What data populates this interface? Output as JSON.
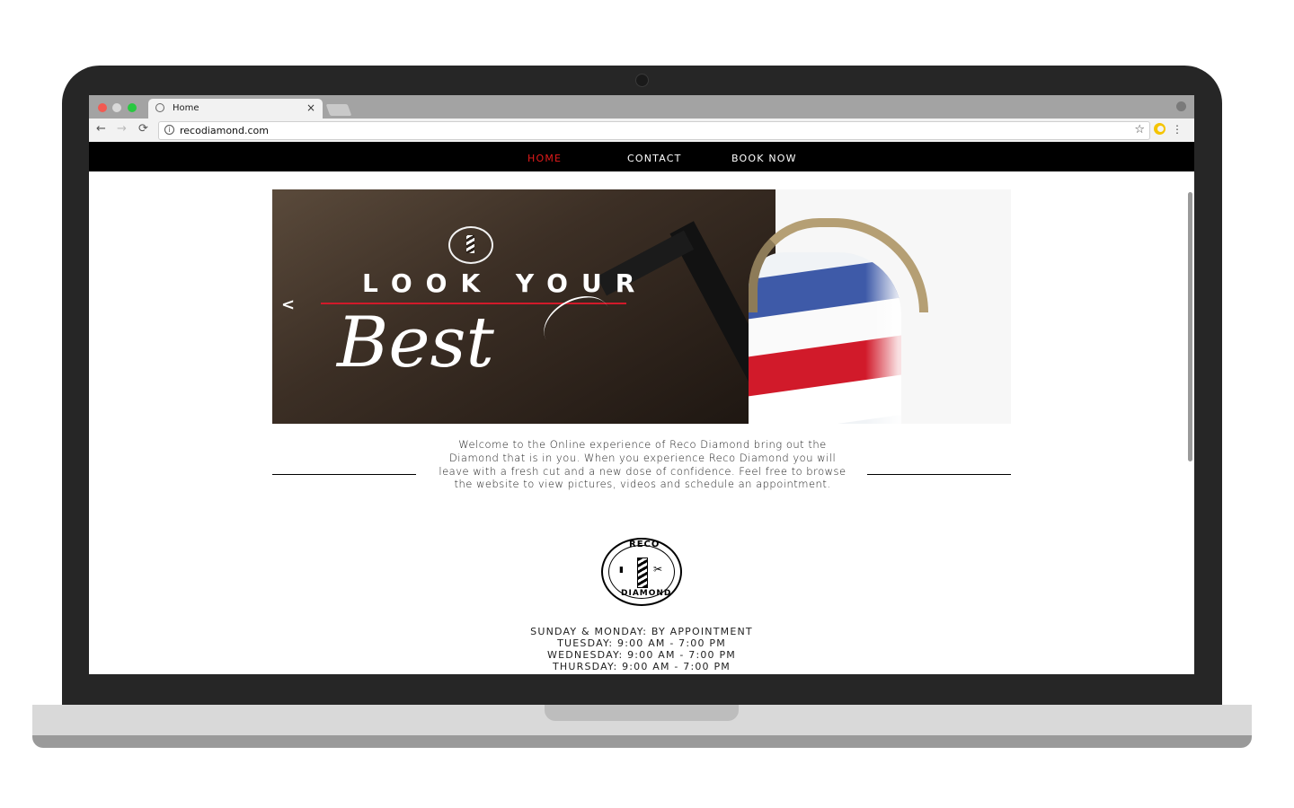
{
  "browser": {
    "tab_title": "Home",
    "tab_close": "×",
    "url": "recodiamond.com",
    "nav_back": "←",
    "nav_forward": "→",
    "nav_reload": "⟳",
    "star": "☆",
    "menu": "⋮",
    "info": "i"
  },
  "site": {
    "nav": [
      {
        "label": "HOME",
        "active": true
      },
      {
        "label": "CONTACT",
        "active": false
      },
      {
        "label": "BOOK NOW",
        "active": false
      }
    ],
    "hero": {
      "prev_arrow": "<",
      "headline": "LOOK YOUR",
      "script": "Best"
    },
    "welcome": "Welcome to the Online experience of Reco Diamond  bring out the Diamond  that is in you. When you experience Reco Diamond  you will leave with a fresh cut and a new dose of confidence. Feel free to browse the website to view pictures, videos and schedule an appointment.",
    "logo": {
      "top": "RECO",
      "bottom": "DIAMOND"
    },
    "hours": [
      "SUNDAY & MONDAY: BY APPOINTMENT",
      "TUESDAY: 9:00 AM - 7:00 PM",
      "WEDNESDAY: 9:00 AM - 7:00 PM",
      "THURSDAY: 9:00 AM - 7:00 PM"
    ]
  },
  "colors": {
    "nav_active": "#e31b1b",
    "nav_bg": "#000000",
    "hero_rule": "#d11a2a"
  },
  "icons": {
    "tab_favicon": "globe-icon",
    "url_info": "info-icon",
    "bookmark": "star-icon",
    "extension": "extension-icon",
    "profile": "profile-icon",
    "menu": "menu-dots-icon"
  }
}
